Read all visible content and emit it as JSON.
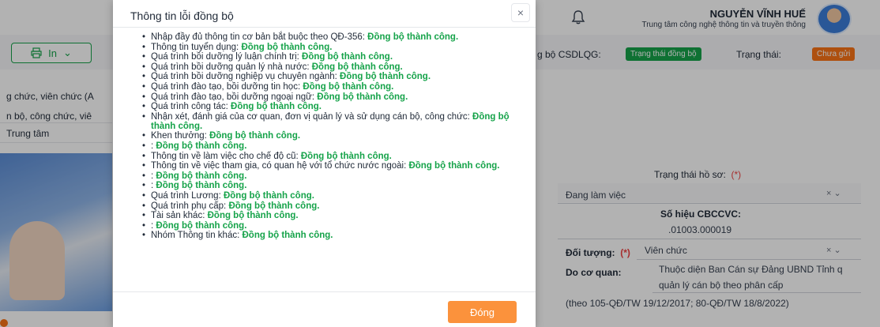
{
  "header": {
    "user_name": "NGUYỄN VĨNH HUẾ",
    "user_org": "Trung tâm công nghệ thông tin và truyền thông"
  },
  "toolbar": {
    "print_label": "In",
    "sync_label": "g bộ CSDLQG:",
    "sync_badge": "Trạng thái đồng bộ",
    "status_label": "Trạng thái:",
    "status_badge": "Chưa gửi"
  },
  "left": {
    "line1": "g chức, viên chức (A",
    "line2": "n bộ, công chức, viê",
    "line3": "Trung tâm"
  },
  "right": {
    "profile_status_label": "Trạng thái hồ sơ:",
    "profile_status_value": "Đang làm việc",
    "code_label": "Số hiệu CBCCVC:",
    "code_value": ".01003.000019",
    "object_label": "Đối tượng:",
    "object_value": "Viên chức",
    "agency_label": "Do cơ quan:",
    "agency_value_1": "Thuộc diện Ban Cán sự Đảng UBND Tỉnh q",
    "agency_value_2": "quản lý cán bộ theo phân cấp",
    "note": "(theo 105-QĐ/TW 19/12/2017; 80-QĐ/TW 18/8/2022)",
    "required_mark": "(*)"
  },
  "modal": {
    "title": "Thông tin lỗi đồng bộ",
    "close_label": "Đóng",
    "items": [
      {
        "label": "Nhập đầy đủ thông tin cơ bản bắt buộc theo QĐ-356:",
        "status": "Đồng bộ thành công."
      },
      {
        "label": "Thông tin tuyển dụng:",
        "status": "Đồng bộ thành công."
      },
      {
        "label": "Quá trình bồi dưỡng lý luận chính trị:",
        "status": "Đồng bộ thành công."
      },
      {
        "label": "Quá trình bồi dưỡng quản lý nhà nước:",
        "status": "Đồng bộ thành công."
      },
      {
        "label": "Quá trình bồi dưỡng nghiệp vụ chuyên ngành:",
        "status": "Đồng bộ thành công."
      },
      {
        "label": "Quá trình đào tạo, bồi dưỡng tin học:",
        "status": "Đồng bộ thành công."
      },
      {
        "label": "Quá trình đào tạo, bồi dưỡng ngoại ngữ:",
        "status": "Đồng bộ thành công."
      },
      {
        "label": "Quá trình công tác:",
        "status": "Đồng bộ thành công."
      },
      {
        "label": "Nhận xét, đánh giá của cơ quan, đơn vị quản lý và sử dụng cán bộ, công chức:",
        "status": "Đồng bộ thành công."
      },
      {
        "label": "Khen thưởng:",
        "status": "Đồng bộ thành công."
      },
      {
        "label": ":",
        "status": "Đồng bộ thành công."
      },
      {
        "label": "Thông tin về làm việc cho chế độ cũ:",
        "status": "Đồng bộ thành công."
      },
      {
        "label": "Thông tin về việc tham gia, có quan hệ với tổ chức nước ngoài:",
        "status": "Đồng bộ thành công."
      },
      {
        "label": ":",
        "status": "Đồng bộ thành công."
      },
      {
        "label": ":",
        "status": "Đồng bộ thành công."
      },
      {
        "label": "Quá trình Lương:",
        "status": "Đồng bộ thành công."
      },
      {
        "label": "Quá trình phụ cấp:",
        "status": "Đồng bộ thành công."
      },
      {
        "label": "Tài sản khác:",
        "status": "Đồng bộ thành công."
      },
      {
        "label": ":",
        "status": "Đồng bộ thành công."
      },
      {
        "label": "Nhóm Thông tin khác:",
        "status": "Đồng bộ thành công."
      }
    ]
  },
  "colors": {
    "success": "#16a34a",
    "warning": "#f97316",
    "primary_button": "#fb923c"
  }
}
